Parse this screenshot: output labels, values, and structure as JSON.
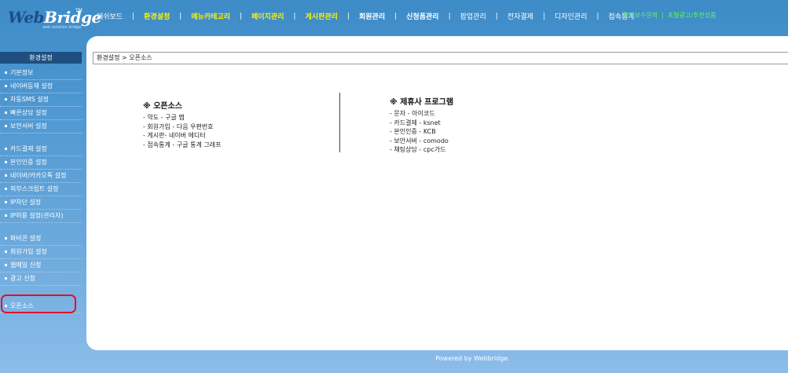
{
  "logo": {
    "part1": "Web",
    "part2": "Bridge",
    "tm": "TM",
    "tagline": "web solution bridge"
  },
  "nav": [
    {
      "label": "대쉬보드",
      "style": "normal"
    },
    {
      "label": "환경설정",
      "style": "active"
    },
    {
      "label": "메뉴카테고리",
      "style": "active"
    },
    {
      "label": "페이지관리",
      "style": "active"
    },
    {
      "label": "게시판관리",
      "style": "active"
    },
    {
      "label": "회원관리",
      "style": "bold"
    },
    {
      "label": "신청폼관리",
      "style": "bold"
    },
    {
      "label": "팝업관리",
      "style": "normal"
    },
    {
      "label": "전자결제",
      "style": "normal"
    },
    {
      "label": "디자인관리",
      "style": "normal"
    },
    {
      "label": "접속통계",
      "style": "normal"
    }
  ],
  "top_links": [
    "유지보수문의",
    "포털광고/추천상품"
  ],
  "sidebar": {
    "title": "환경설정",
    "groups": [
      [
        "기본정보",
        "네이버등재 설정",
        "자동SMS 설정",
        "빠른상담 설정",
        "보안서버 설정"
      ],
      [
        "카드결제 설정",
        "본인인증 설정",
        "네이버/카카오톡 설정",
        "외부스크립트 설정",
        "IP차단 설정",
        "IP허용 설정(관리자)"
      ],
      [
        "파비콘 설정",
        "회원가입 설정",
        "웹메일 신청",
        "광고 신청"
      ],
      [
        "오픈소스"
      ]
    ]
  },
  "breadcrumb": "환경설정 > 오픈소스",
  "left_section": {
    "heading": "※ 오픈소스",
    "lines": [
      "- 약도 - 구글 맵",
      "- 회원가입 - 다음 우편번호",
      "- 게시판- 네이버 에디터",
      "- 접속통계 - 구글 통계 그래프"
    ]
  },
  "right_section": {
    "heading": "※ 제휴사 프로그램",
    "lines": [
      "- 문자 - 아이코드",
      "- 카드결제 - ksnet",
      "- 본인인증 - KCB",
      "- 보안서버 - comodo",
      "- 채팅상담 - cpc가드"
    ]
  },
  "footer": "Powered by Webbridge.",
  "colors": {
    "active_nav": "#fff200",
    "top_links": "#5cff4a",
    "highlight_ring": "#e3102a",
    "sidebar_title_bg": "#1e4f80"
  }
}
